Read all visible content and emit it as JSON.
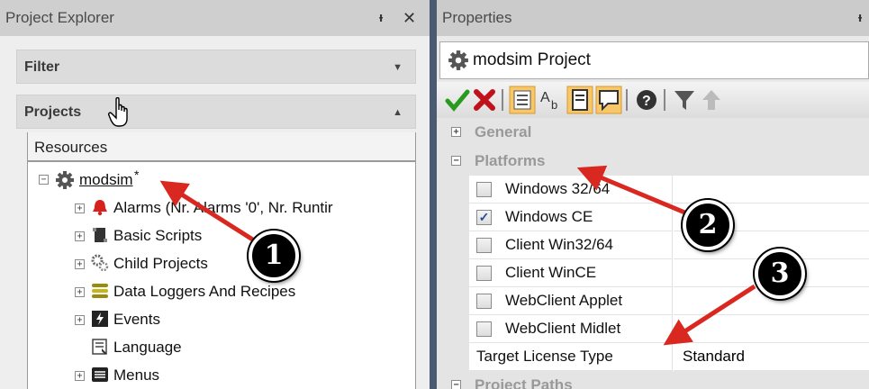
{
  "project_explorer": {
    "title": "Project Explorer",
    "pin_glyph": "ᵼ",
    "close_glyph": "✕",
    "filter_label": "Filter",
    "projects_label": "Projects",
    "resources_header": "Resources",
    "tree": [
      {
        "label": "modsim",
        "suffix": "*",
        "expander": "−",
        "icon": "gear-icon"
      },
      {
        "label": "Alarms (Nr. Alarms '0', Nr. Runtir",
        "expander": "+",
        "icon": "bell-icon"
      },
      {
        "label": "Basic Scripts",
        "expander": "+",
        "icon": "script-icon"
      },
      {
        "label": "Child Projects",
        "expander": "+",
        "icon": "gears-icon"
      },
      {
        "label": "Data Loggers And Recipes",
        "expander": "+",
        "icon": "database-icon"
      },
      {
        "label": "Events",
        "expander": "+",
        "icon": "events-icon"
      },
      {
        "label": "Language",
        "expander": "",
        "icon": "language-icon"
      },
      {
        "label": "Menus",
        "expander": "+",
        "icon": "menu-icon"
      }
    ]
  },
  "properties": {
    "title": "Properties",
    "object_name": "modsim Project",
    "categories": {
      "general": {
        "label": "General",
        "expander": "+"
      },
      "platforms": {
        "label": "Platforms",
        "expander": "−"
      },
      "project_paths": {
        "label": "Project Paths",
        "expander": "−"
      }
    },
    "platform_rows": [
      {
        "label": "Windows 32/64",
        "checked": false
      },
      {
        "label": "Windows CE",
        "checked": true
      },
      {
        "label": "Client Win32/64",
        "checked": false
      },
      {
        "label": "Client WinCE",
        "checked": false
      },
      {
        "label": "WebClient Applet",
        "checked": false
      },
      {
        "label": "WebClient Midlet",
        "checked": false
      }
    ],
    "license_row": {
      "label": "Target License Type",
      "value": "Standard"
    }
  },
  "annotations": [
    {
      "number": "1"
    },
    {
      "number": "2"
    },
    {
      "number": "3"
    }
  ],
  "colors": {
    "arrow": "#d9281f",
    "badge": "#000000"
  }
}
